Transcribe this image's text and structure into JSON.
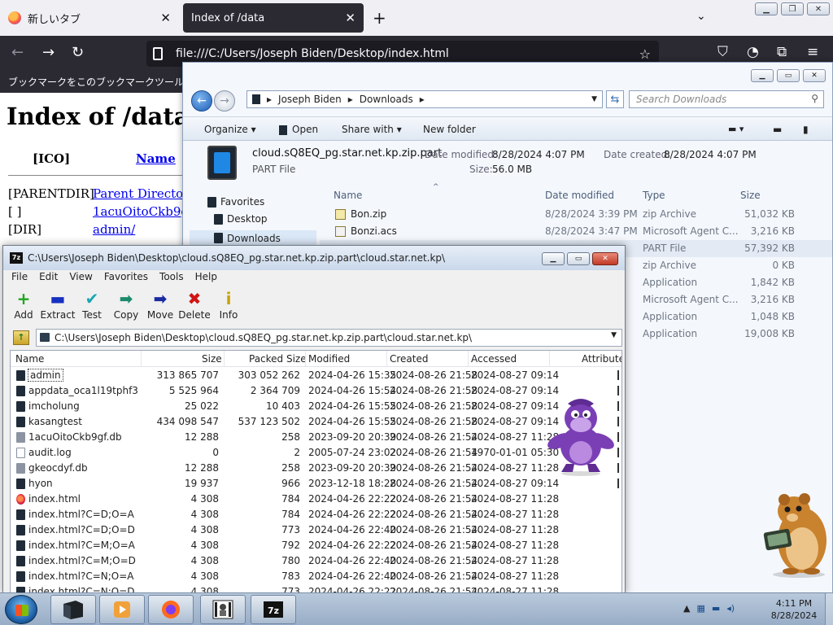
{
  "firefox": {
    "tabs": [
      {
        "label": "新しいタブ",
        "active": false
      },
      {
        "label": "Index of /data",
        "active": true
      }
    ],
    "url": "file:///C:/Users/Joseph Biden/Desktop/index.html",
    "bookmarks_hint": "ブックマークをこのブックマークツール"
  },
  "web_page": {
    "heading": "Index of /data",
    "col_icon": "[ICO]",
    "col_name": "Name",
    "rows": [
      {
        "type": "[PARENTDIR]",
        "link": "Parent Directory"
      },
      {
        "type": "[ ]",
        "link": "1acuOitoCkb9gf."
      },
      {
        "type": "[DIR]",
        "link": "admin/"
      }
    ]
  },
  "explorer": {
    "breadcrumb": [
      "Joseph Biden",
      "Downloads"
    ],
    "search_placeholder": "Search Downloads",
    "commands": [
      "Organize",
      "Open",
      "Share with",
      "New folder"
    ],
    "details": {
      "filename": "cloud.sQ8EQ_pg.star.net.kp.zip.part",
      "type": "PART File",
      "modified_label": "Date modified:",
      "modified": "8/28/2024 4:07 PM",
      "created_label": "Date created:",
      "created": "8/28/2024 4:07 PM",
      "size_label": "Size:",
      "size": "56.0 MB"
    },
    "nav": [
      {
        "label": "Favorites"
      },
      {
        "label": "Desktop"
      },
      {
        "label": "Downloads"
      }
    ],
    "columns": [
      "Name",
      "Date modified",
      "Type",
      "Size"
    ],
    "files": [
      {
        "name": "Bon.zip",
        "date": "8/28/2024 3:39 PM",
        "type": "zip Archive",
        "size": "51,032 KB"
      },
      {
        "name": "Bonzi.acs",
        "date": "8/28/2024 3:47 PM",
        "type": "Microsoft Agent C...",
        "size": "3,216 KB"
      },
      {
        "name": "",
        "date": "",
        "type": "PART File",
        "size": "57,392 KB"
      },
      {
        "name": "",
        "date": "",
        "type": "zip Archive",
        "size": "0 KB"
      },
      {
        "name": "",
        "date": "",
        "type": "Application",
        "size": "1,842 KB"
      },
      {
        "name": "",
        "date": "",
        "type": "Microsoft Agent C...",
        "size": "3,216 KB"
      },
      {
        "name": "",
        "date": "",
        "type": "Application",
        "size": "1,048 KB"
      },
      {
        "name": "",
        "date": "",
        "type": "Application",
        "size": "19,008 KB"
      }
    ]
  },
  "sevenzip": {
    "title": "C:\\Users\\Joseph Biden\\Desktop\\cloud.sQ8EQ_pg.star.net.kp.zip.part\\cloud.star.net.kp\\",
    "path": "C:\\Users\\Joseph Biden\\Desktop\\cloud.sQ8EQ_pg.star.net.kp.zip.part\\cloud.star.net.kp\\",
    "menu": [
      "File",
      "Edit",
      "View",
      "Favorites",
      "Tools",
      "Help"
    ],
    "toolbar": [
      {
        "label": "Add",
        "icon": "+",
        "color": "#1fa61f"
      },
      {
        "label": "Extract",
        "icon": "▬",
        "color": "#1630c0"
      },
      {
        "label": "Test",
        "icon": "✔",
        "color": "#1aa6b0"
      },
      {
        "label": "Copy",
        "icon": "➡",
        "color": "#1a8a6a"
      },
      {
        "label": "Move",
        "icon": "➡",
        "color": "#1a2aa0"
      },
      {
        "label": "Delete",
        "icon": "✖",
        "color": "#d01414"
      },
      {
        "label": "Info",
        "icon": "i",
        "color": "#c9a400"
      }
    ],
    "columns": [
      "Name",
      "Size",
      "Packed Size",
      "Modified",
      "Created",
      "Accessed",
      "Attribute"
    ],
    "rows": [
      {
        "icon": "dir",
        "name": "admin",
        "size": "313 865 707",
        "packed": "303 052 262",
        "modified": "2024-04-26 15:35",
        "created": "2024-08-26 21:58",
        "accessed": "2024-08-27 09:14"
      },
      {
        "icon": "dir",
        "name": "appdata_oca1l19tphf3",
        "size": "5 525 964",
        "packed": "2 364 709",
        "modified": "2024-04-26 15:54",
        "created": "2024-08-26 21:58",
        "accessed": "2024-08-27 09:14"
      },
      {
        "icon": "dir",
        "name": "imcholung",
        "size": "25 022",
        "packed": "10 403",
        "modified": "2024-04-26 15:55",
        "created": "2024-08-26 21:58",
        "accessed": "2024-08-27 09:14"
      },
      {
        "icon": "dir",
        "name": "kasangtest",
        "size": "434 098 547",
        "packed": "537 123 502",
        "modified": "2024-04-26 15:55",
        "created": "2024-08-26 21:58",
        "accessed": "2024-08-27 09:14"
      },
      {
        "icon": "db",
        "name": "1acuOitoCkb9gf.db",
        "size": "12 288",
        "packed": "258",
        "modified": "2023-09-20 20:39",
        "created": "2024-08-26 21:54",
        "accessed": "2024-08-27 11:28"
      },
      {
        "icon": "file",
        "name": "audit.log",
        "size": "0",
        "packed": "2",
        "modified": "2005-07-24 23:02",
        "created": "2024-08-26 21:54",
        "accessed": "1970-01-01 05:30"
      },
      {
        "icon": "db",
        "name": "gkeocdyf.db",
        "size": "12 288",
        "packed": "258",
        "modified": "2023-09-20 20:39",
        "created": "2024-08-26 21:54",
        "accessed": "2024-08-27 11:28"
      },
      {
        "icon": "dir",
        "name": "hyon",
        "size": "19 937",
        "packed": "966",
        "modified": "2023-12-18 18:28",
        "created": "2024-08-26 21:54",
        "accessed": "2024-08-27 09:14"
      },
      {
        "icon": "html",
        "name": "index.html",
        "size": "4 308",
        "packed": "784",
        "modified": "2024-04-26 22:22",
        "created": "2024-08-26 21:54",
        "accessed": "2024-08-27 11:28"
      },
      {
        "icon": "dir",
        "name": "index.html?C=D;O=A",
        "size": "4 308",
        "packed": "784",
        "modified": "2024-04-26 22:22",
        "created": "2024-08-26 21:54",
        "accessed": "2024-08-27 11:28"
      },
      {
        "icon": "dir",
        "name": "index.html?C=D;O=D",
        "size": "4 308",
        "packed": "773",
        "modified": "2024-04-26 22:40",
        "created": "2024-08-26 21:54",
        "accessed": "2024-08-27 11:28"
      },
      {
        "icon": "dir",
        "name": "index.html?C=M;O=A",
        "size": "4 308",
        "packed": "792",
        "modified": "2024-04-26 22:22",
        "created": "2024-08-26 21:54",
        "accessed": "2024-08-27 11:28"
      },
      {
        "icon": "dir",
        "name": "index.html?C=M;O=D",
        "size": "4 308",
        "packed": "780",
        "modified": "2024-04-26 22:40",
        "created": "2024-08-26 21:54",
        "accessed": "2024-08-27 11:28"
      },
      {
        "icon": "dir",
        "name": "index.html?C=N;O=A",
        "size": "4 308",
        "packed": "783",
        "modified": "2024-04-26 22:40",
        "created": "2024-08-26 21:54",
        "accessed": "2024-08-27 11:28"
      },
      {
        "icon": "dir",
        "name": "index.html?C=N;O=D",
        "size": "4 308",
        "packed": "773",
        "modified": "2024-04-26 22:22",
        "created": "2024-08-26 21:54",
        "accessed": "2024-08-27 11:28"
      }
    ]
  },
  "taskbar": {
    "time": "4:11 PM",
    "date": "8/28/2024",
    "apps": [
      "explorer-icon",
      "media-player-icon",
      "firefox-icon",
      "bonzi-agent-icon",
      "7zip-icon"
    ]
  },
  "colors": {
    "link": "#0000ee",
    "ff_dark": "#2b2a33",
    "accent": "#1f88e5"
  }
}
